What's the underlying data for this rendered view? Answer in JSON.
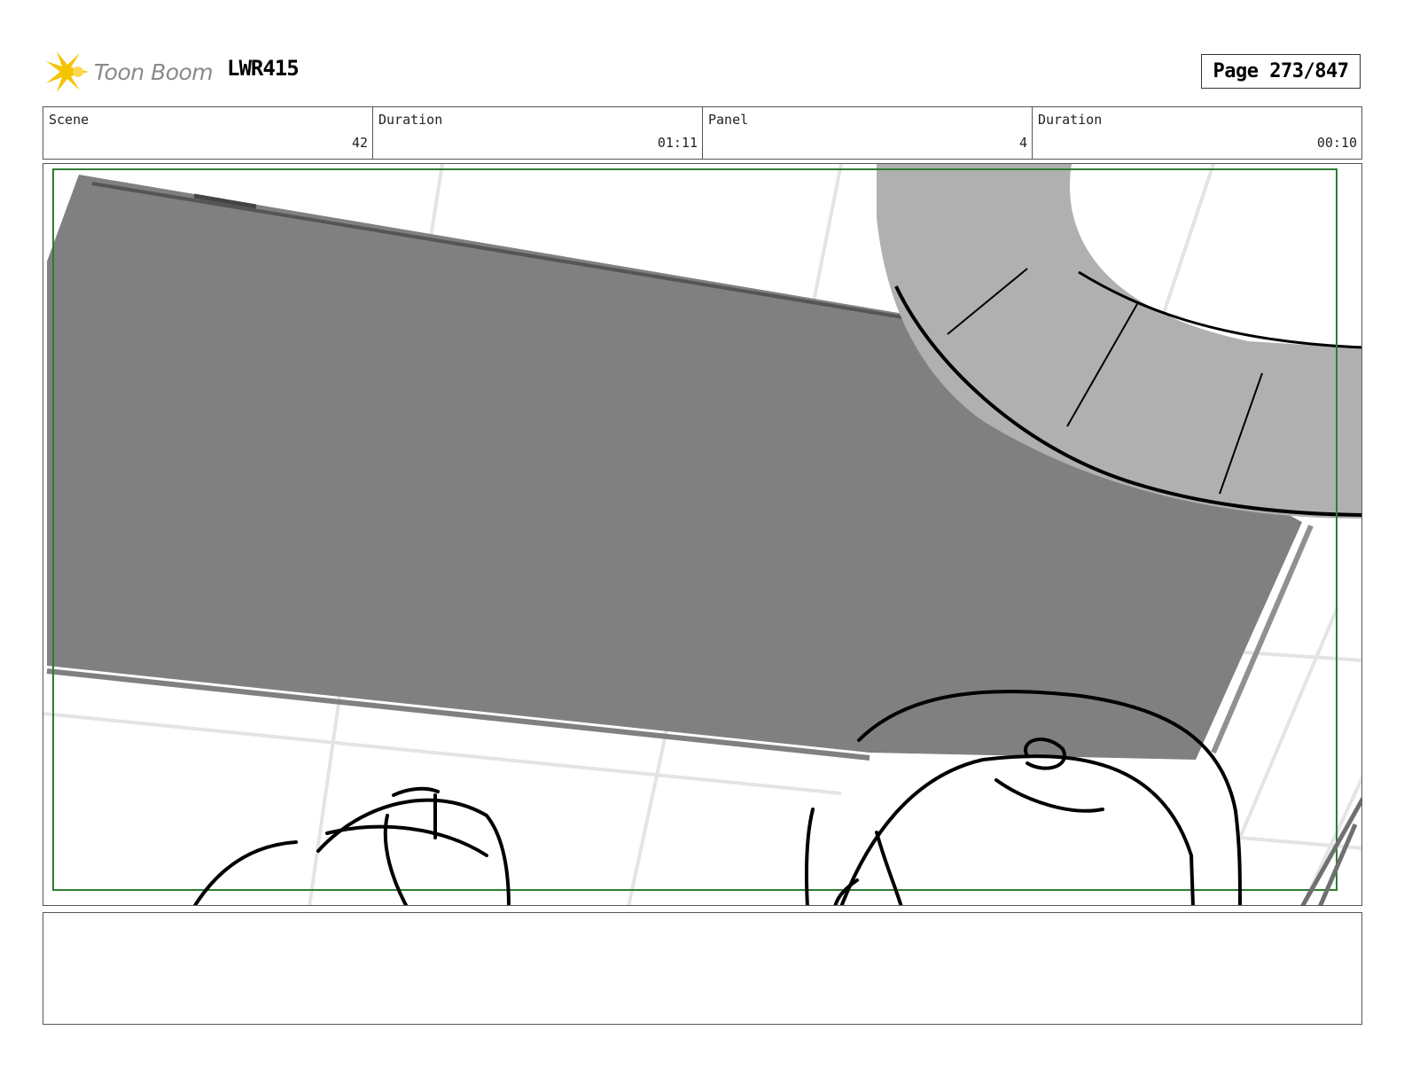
{
  "header": {
    "logo_text": "Toon Boom",
    "project_code": "LWR415",
    "page_label": "Page 273/847"
  },
  "info_bar": [
    {
      "label": "Scene",
      "value": "42"
    },
    {
      "label": "Duration",
      "value": "01:11"
    },
    {
      "label": "Panel",
      "value": "4"
    },
    {
      "label": "Duration",
      "value": "00:10"
    }
  ],
  "notes": {
    "text": ""
  },
  "colors": {
    "logo_star": "#f5c400",
    "logo_text": "#8a8a8a",
    "safe_frame": "#2e7d32",
    "dark_fill": "#808080",
    "light_fill": "#b0b0b0"
  },
  "icons": {
    "logo": "toon-boom-star-icon"
  }
}
